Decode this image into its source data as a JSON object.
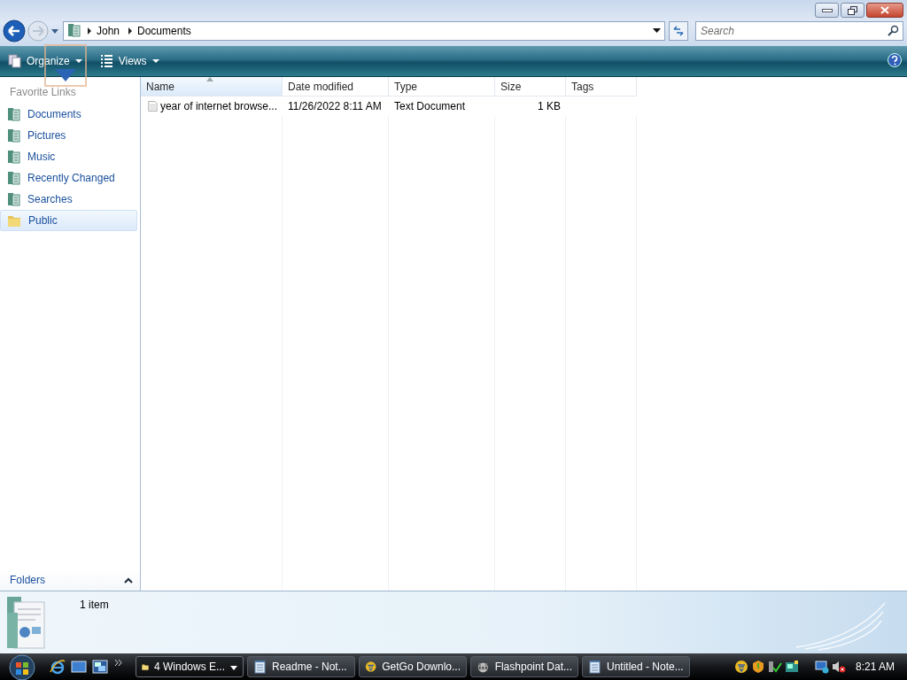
{
  "address": {
    "breadcrumbs": [
      "John",
      "Documents"
    ]
  },
  "search": {
    "placeholder": "Search"
  },
  "toolbar": {
    "buttons": [
      "Organize",
      "Views"
    ]
  },
  "sidebar": {
    "heading": "Favorite Links",
    "items": [
      {
        "label": "Documents",
        "kind": "library",
        "selected": false
      },
      {
        "label": "Pictures",
        "kind": "library",
        "selected": false
      },
      {
        "label": "Music",
        "kind": "library",
        "selected": false
      },
      {
        "label": "Recently Changed",
        "kind": "library",
        "selected": false
      },
      {
        "label": "Searches",
        "kind": "library",
        "selected": false
      },
      {
        "label": "Public",
        "kind": "folder",
        "selected": true
      }
    ],
    "folders": "Folders"
  },
  "table": {
    "columns": [
      {
        "label": "Name",
        "sorted": true
      },
      {
        "label": "Date modified",
        "sorted": false
      },
      {
        "label": "Type",
        "sorted": false
      },
      {
        "label": "Size",
        "sorted": false
      },
      {
        "label": "Tags",
        "sorted": false
      }
    ],
    "rows": [
      {
        "cells": [
          "year of internet browse...",
          "11/26/2022 8:11 AM",
          "Text Document",
          "1 KB"
        ]
      }
    ]
  },
  "details": {
    "text": "1 item"
  },
  "taskbar": {
    "tasks": [
      {
        "label": "4 Windows E...",
        "kind": "folder",
        "selected": true
      },
      {
        "label": "Readme - Not...",
        "kind": "notepad",
        "selected": false
      },
      {
        "label": "GetGo Downlo...",
        "kind": "download",
        "selected": false
      },
      {
        "label": "Flashpoint Dat...",
        "kind": "raccoon",
        "selected": false
      },
      {
        "label": "Untitled - Note...",
        "kind": "notepad",
        "selected": false
      }
    ],
    "clock": "8:21 AM"
  }
}
